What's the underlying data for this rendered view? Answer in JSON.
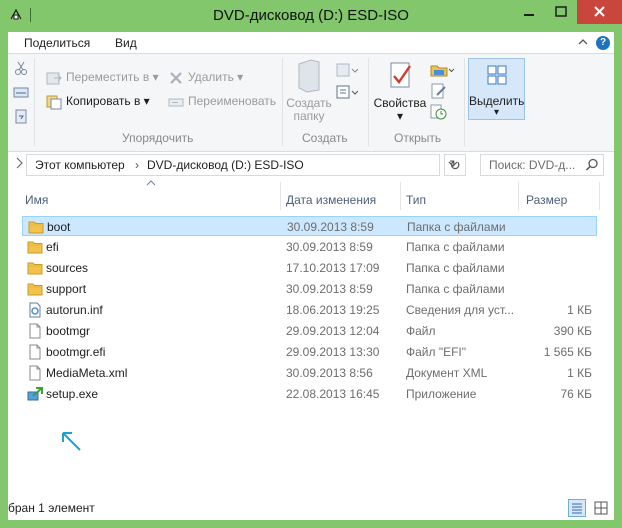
{
  "window": {
    "title": "DVD-дисковод (D:) ESD-ISO"
  },
  "menu": {
    "share": "Поделиться",
    "view": "Вид",
    "help": "?"
  },
  "ribbon": {
    "move_to": "Переместить в",
    "copy_to": "Копировать в",
    "delete": "Удалить",
    "rename": "Переименовать",
    "organize_group": "Упорядочить",
    "new_folder_line1": "Создать",
    "new_folder_line2": "папку",
    "create_group": "Создать",
    "properties": "Свойства",
    "open_group": "Открыть",
    "select": "Выделить",
    "dropdown_glyph": "▾"
  },
  "address": {
    "path_root": "Этот компьютер",
    "path_current": "DVD-дисковод (D:) ESD-ISO",
    "separator": "›",
    "refresh_glyph": "↻",
    "search_placeholder": "Поиск: DVD-д..."
  },
  "columns": {
    "name": "Имя",
    "date": "Дата изменения",
    "type": "Тип",
    "size": "Размер"
  },
  "files": [
    {
      "name": "boot",
      "date": "30.09.2013 8:59",
      "type": "Папка с файлами",
      "size": "",
      "icon": "folder",
      "selected": true
    },
    {
      "name": "efi",
      "date": "30.09.2013 8:59",
      "type": "Папка с файлами",
      "size": "",
      "icon": "folder",
      "selected": false
    },
    {
      "name": "sources",
      "date": "17.10.2013 17:09",
      "type": "Папка с файлами",
      "size": "",
      "icon": "folder",
      "selected": false
    },
    {
      "name": "support",
      "date": "30.09.2013 8:59",
      "type": "Папка с файлами",
      "size": "",
      "icon": "folder",
      "selected": false
    },
    {
      "name": "autorun.inf",
      "date": "18.06.2013 19:25",
      "type": "Сведения для уст...",
      "size": "1 КБ",
      "icon": "settings-file",
      "selected": false
    },
    {
      "name": "bootmgr",
      "date": "29.09.2013 12:04",
      "type": "Файл",
      "size": "390 КБ",
      "icon": "file",
      "selected": false
    },
    {
      "name": "bootmgr.efi",
      "date": "29.09.2013 13:30",
      "type": "Файл \"EFI\"",
      "size": "1 565 КБ",
      "icon": "file",
      "selected": false
    },
    {
      "name": "MediaMeta.xml",
      "date": "30.09.2013 8:56",
      "type": "Документ XML",
      "size": "1 КБ",
      "icon": "file",
      "selected": false
    },
    {
      "name": "setup.exe",
      "date": "22.08.2013 16:45",
      "type": "Приложение",
      "size": "76 КБ",
      "icon": "setup-exe",
      "selected": false
    }
  ],
  "status": {
    "text": "бран 1 элемент"
  },
  "colors": {
    "frame": "#82c76b",
    "selection_bg": "#cce8ff",
    "selection_border": "#99d1ff",
    "close_button": "#c9463d"
  }
}
